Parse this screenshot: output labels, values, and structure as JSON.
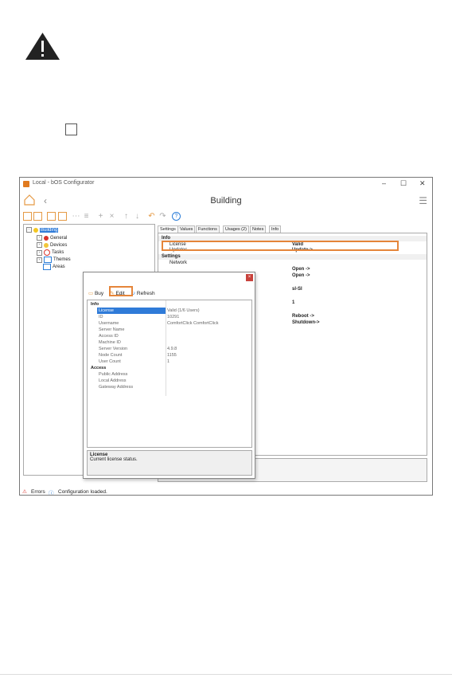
{
  "app": {
    "title": "Local - bOS Configurator",
    "page_title": "Building",
    "window_controls": [
      "–",
      "☐",
      "✕"
    ]
  },
  "tree": {
    "root": "Building",
    "children": [
      "General",
      "Devices",
      "Tasks",
      "Themes",
      "Areas"
    ]
  },
  "tabs": [
    "Settings",
    "Values",
    "Functions",
    "Usages (2)",
    "Notes",
    "Info"
  ],
  "settings": {
    "rows": [
      {
        "key": "Info",
        "value": "",
        "section": true
      },
      {
        "key": "License",
        "value": "Valid"
      },
      {
        "key": "Updates",
        "value": "Update->"
      },
      {
        "key": "Settings",
        "value": "",
        "section": true
      },
      {
        "key": "Network",
        "value": ""
      },
      {
        "key": "",
        "value": "Open ->"
      },
      {
        "key": "",
        "value": "Open ->"
      },
      {
        "key": "",
        "value": ""
      },
      {
        "key": "",
        "value": "sl-SI"
      },
      {
        "key": "",
        "value": ""
      },
      {
        "key": "",
        "value": "1"
      },
      {
        "key": "",
        "value": ""
      },
      {
        "key": "",
        "value": "Reboot ->"
      },
      {
        "key": "",
        "value": "Shutdown->"
      }
    ]
  },
  "status": {
    "errors": "Errors",
    "message": "Configuration loaded."
  },
  "dialog": {
    "buy": "Buy",
    "edit": "Edit",
    "refresh": "Refresh",
    "rows": [
      {
        "key": "Info",
        "value": "",
        "section": true
      },
      {
        "key": "License",
        "value": "Valid (1/6 Users)",
        "selected": true
      },
      {
        "key": "ID",
        "value": "10291"
      },
      {
        "key": "Username",
        "value": "ComfortClick ComfortClick"
      },
      {
        "key": "Server Name",
        "value": ""
      },
      {
        "key": "Access ID",
        "value": ""
      },
      {
        "key": "Machine ID",
        "value": ""
      },
      {
        "key": "Server Version",
        "value": "4.9.8"
      },
      {
        "key": "Node Count",
        "value": "1155"
      },
      {
        "key": "User Count",
        "value": "1"
      },
      {
        "key": "Access",
        "value": "",
        "section": true
      },
      {
        "key": "Public Address",
        "value": ""
      },
      {
        "key": "Local Address",
        "value": ""
      },
      {
        "key": "Gateway Address",
        "value": ""
      }
    ],
    "desc_title": "License",
    "desc_text": "Current license status."
  },
  "colors": {
    "accent_orange": "#e5853a",
    "selection_blue": "#2f7bd8",
    "close_red": "#c8423c"
  }
}
